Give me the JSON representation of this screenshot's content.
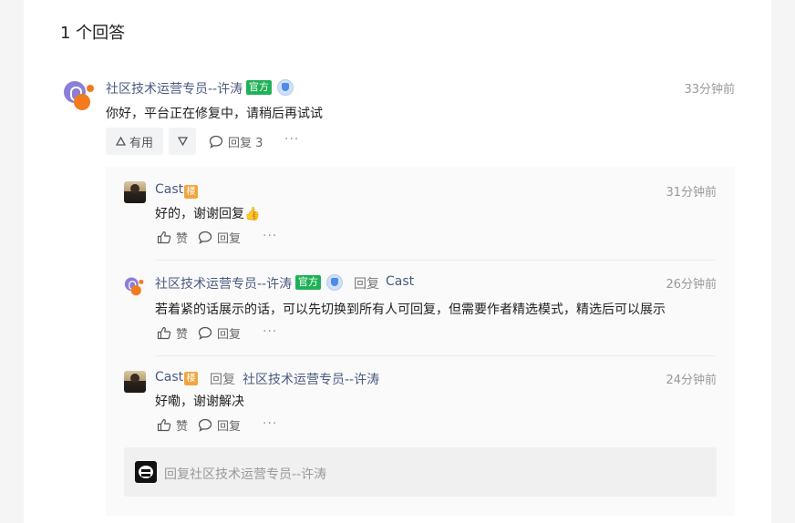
{
  "answers_title": "1 个回答",
  "answer": {
    "author": "社区技术运营专员--许涛",
    "official_badge": "官方",
    "time": "33分钟前",
    "content": "你好，平台正在修复中，请稍后再试试",
    "useful_label": "有用",
    "reply_label": "回复 3",
    "more": "···"
  },
  "replies": [
    {
      "author": "Cast",
      "floor_badge": "楼",
      "time": "31分钟前",
      "content": "好的，谢谢回复👍",
      "like_label": "赞",
      "reply_label": "回复",
      "more": "···"
    },
    {
      "author": "社区技术运营专员--许涛",
      "official_badge": "官方",
      "reply_word": "回复",
      "reply_target": "Cast",
      "time": "26分钟前",
      "content": "若着紧的话展示的话，可以先切换到所有人可回复，但需要作者精选模式，精选后可以展示",
      "like_label": "赞",
      "reply_label": "回复",
      "more": "···"
    },
    {
      "author": "Cast",
      "floor_badge": "楼",
      "reply_word": "回复",
      "reply_target": "社区技术运营专员--许涛",
      "time": "24分钟前",
      "content": "好嘞，谢谢解决",
      "like_label": "赞",
      "reply_label": "回复",
      "more": "···"
    }
  ],
  "reply_input": {
    "placeholder": "回复社区技术运营专员--许涛"
  },
  "colors": {
    "official_green": "#20b157",
    "floor_orange": "#f0a640",
    "name_blue": "#4a5a80"
  }
}
